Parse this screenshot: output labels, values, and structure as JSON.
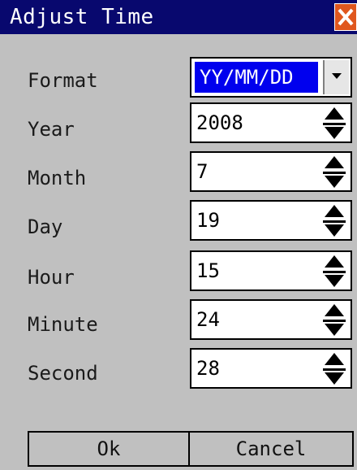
{
  "window": {
    "title": "Adjust Time"
  },
  "icons": {
    "close": "close-icon",
    "dropdown": "dropdown-arrow-icon",
    "up": "arrow-up-icon",
    "down": "arrow-down-icon"
  },
  "colors": {
    "titlebar": "#08086e",
    "selection": "#0000ee",
    "close": "#e0571e",
    "background": "#c0c0c0"
  },
  "fields": {
    "format": {
      "label": "Format",
      "value": "YY/MM/DD"
    },
    "year": {
      "label": "Year",
      "value": "2008"
    },
    "month": {
      "label": "Month",
      "value": "7"
    },
    "day": {
      "label": "Day",
      "value": "19"
    },
    "hour": {
      "label": "Hour",
      "value": "15"
    },
    "minute": {
      "label": "Minute",
      "value": "24"
    },
    "second": {
      "label": "Second",
      "value": "28"
    }
  },
  "buttons": {
    "ok": "Ok",
    "cancel": "Cancel"
  }
}
